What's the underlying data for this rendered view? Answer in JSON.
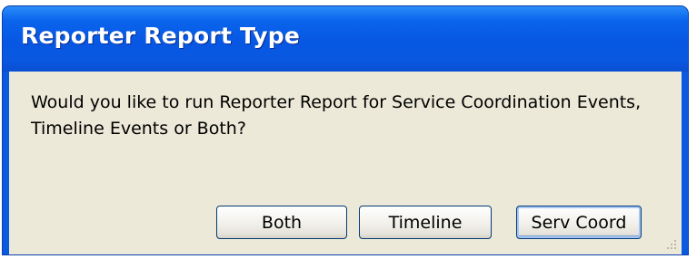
{
  "window": {
    "title": "Reporter Report Type"
  },
  "message": {
    "text": "Would you like to run Reporter Report for Service Coordination Events, Timeline Events or Both?"
  },
  "buttons": {
    "both_label": "Both",
    "timeline_label": "Timeline",
    "serv_coord_label": "Serv Coord"
  },
  "colors": {
    "titlebar": "#0a5ae0",
    "client_background": "#ece9d8",
    "button_border": "#003c74"
  }
}
